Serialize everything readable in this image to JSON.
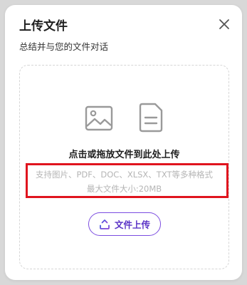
{
  "modal": {
    "title": "上传文件",
    "subtitle": "总结并与您的文件对话"
  },
  "dropzone": {
    "main_text": "点击或拖放文件到此处上传",
    "supported_formats": "支持图片、PDF、DOC、XLSX、TXT等多种格式",
    "max_size": "最大文件大小:20MB"
  },
  "upload_button": {
    "label": "文件上传"
  },
  "icons": {
    "close": "close-icon",
    "image": "image-icon",
    "document": "document-icon",
    "upload": "upload-icon"
  },
  "colors": {
    "accent": "#6a3fd6",
    "highlight": "#e0141e",
    "hint_text": "#b5b5b5"
  }
}
